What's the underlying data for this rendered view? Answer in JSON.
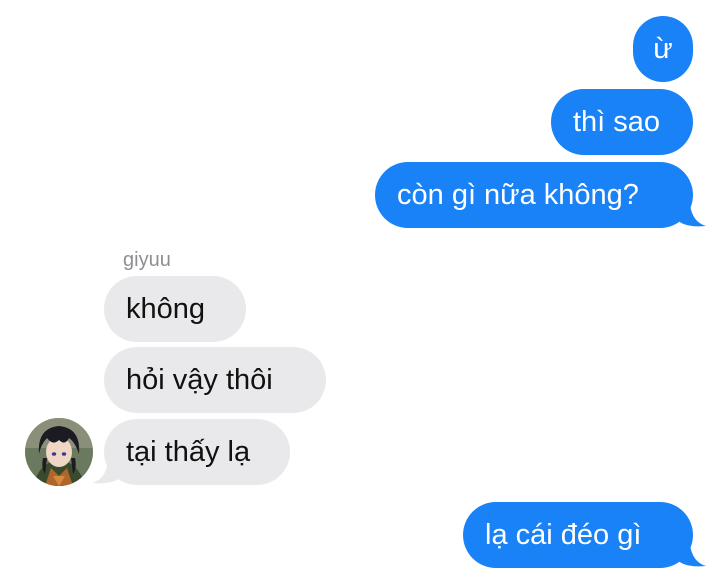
{
  "conversation": {
    "messages": [
      {
        "from": "me",
        "text": "ừ"
      },
      {
        "from": "me",
        "text": "thì sao"
      },
      {
        "from": "me",
        "text": "còn gì nữa không?"
      },
      {
        "from": "giyuu",
        "text": "không"
      },
      {
        "from": "giyuu",
        "text": "hỏi vậy thôi"
      },
      {
        "from": "giyuu",
        "text": "tại thấy lạ"
      },
      {
        "from": "me",
        "text": "lạ cái đéo gì"
      }
    ],
    "sender_name": "giyuu"
  },
  "colors": {
    "outgoing_bubble": "#1a82f7",
    "incoming_bubble": "#e9e9eb",
    "sender_label": "#8e8e93"
  }
}
